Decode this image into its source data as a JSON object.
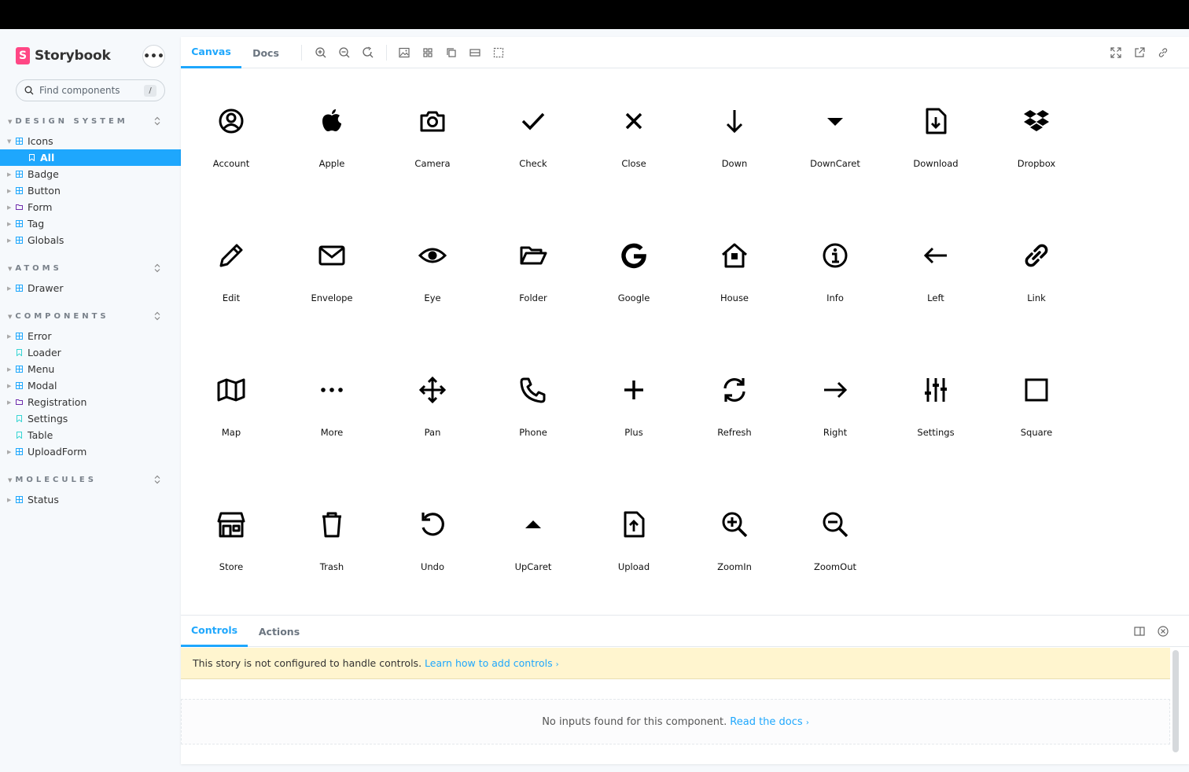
{
  "brand": {
    "name": "Storybook",
    "logo": "S"
  },
  "search": {
    "placeholder": "Find components",
    "shortcut": "/"
  },
  "sidebar": {
    "groups": [
      {
        "title": "DESIGN SYSTEM",
        "items": [
          "Icons",
          "All",
          "Badge",
          "Button",
          "Form",
          "Tag",
          "Globals"
        ]
      },
      {
        "title": "ATOMS",
        "items": [
          "Drawer"
        ]
      },
      {
        "title": "COMPONENTS",
        "items": [
          "Error",
          "Loader",
          "Menu",
          "Modal",
          "Registration",
          "Settings",
          "Table",
          "UploadForm"
        ]
      },
      {
        "title": "MOLECULES",
        "items": [
          "Status"
        ]
      }
    ]
  },
  "toolbar": {
    "tabs": [
      "Canvas",
      "Docs"
    ]
  },
  "icons": [
    "Account",
    "Apple",
    "Camera",
    "Check",
    "Close",
    "Down",
    "DownCaret",
    "Download",
    "Dropbox",
    "Edit",
    "Envelope",
    "Eye",
    "Folder",
    "Google",
    "House",
    "Info",
    "Left",
    "Link",
    "Map",
    "More",
    "Pan",
    "Phone",
    "Plus",
    "Refresh",
    "Right",
    "Settings",
    "Square",
    "Store",
    "Trash",
    "Undo",
    "UpCaret",
    "Upload",
    "ZoomIn",
    "ZoomOut"
  ],
  "addons": {
    "tabs": [
      "Controls",
      "Actions"
    ],
    "warning_text": "This story is not configured to handle controls.",
    "warning_link": "Learn how to add controls",
    "empty_text": "No inputs found for this component.",
    "empty_link": "Read the docs"
  },
  "colors": {
    "accent": "#1ea7fd",
    "brand": "#ff4785",
    "warning_bg": "#fff5cf"
  }
}
